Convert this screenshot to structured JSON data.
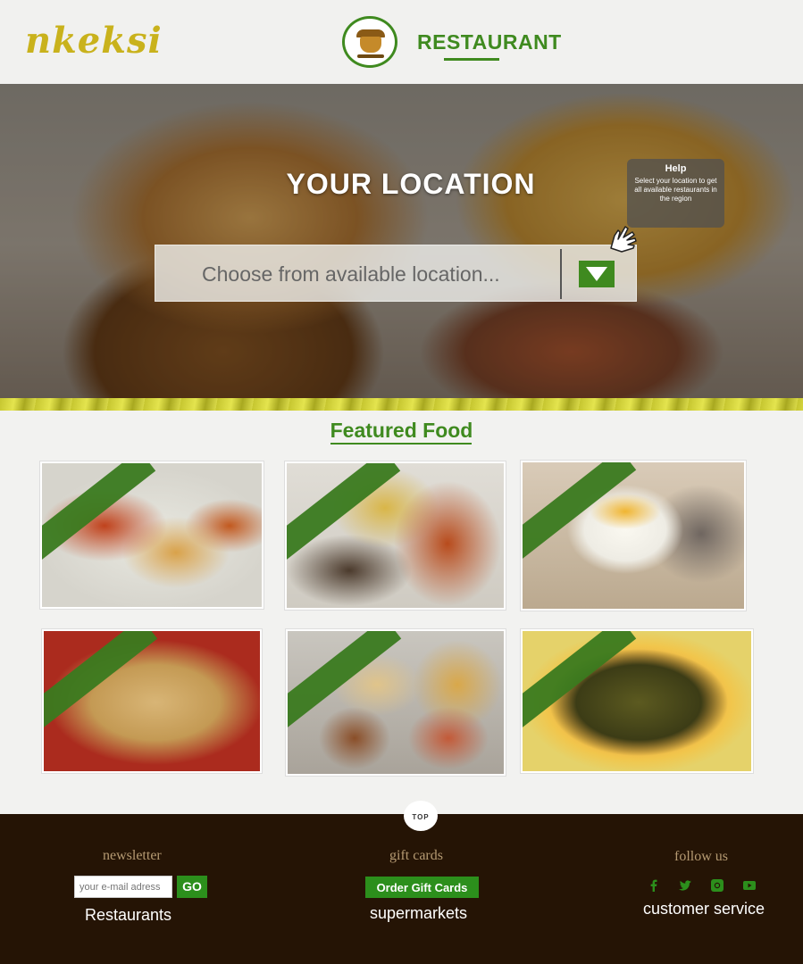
{
  "header": {
    "logo_text_a": "nke",
    "logo_text_b": "ksi",
    "section_title": "RESTAURANT",
    "section_icon": "restaurant-pot-icon"
  },
  "hero": {
    "title": "YOUR LOCATION",
    "location_placeholder": "Choose from available location...",
    "help_title": "Help",
    "help_text": "Select your location to get all available restaurants in the region"
  },
  "featured": {
    "title": "Featured Food",
    "items": [
      "food-1",
      "food-2",
      "food-3",
      "food-4",
      "food-5",
      "food-6"
    ]
  },
  "footer": {
    "top_label": "TOP",
    "newsletter_heading": "newsletter",
    "email_placeholder": "your e-mail adress",
    "go_label": "GO",
    "restaurants_link": "Restaurants",
    "gift_heading": "gift cards",
    "gift_button": "Order Gift Cards",
    "supermarkets_link": "supermarkets",
    "follow_heading": "follow us",
    "customer_service_link": "customer service",
    "social_icons": [
      "facebook-icon",
      "twitter-icon",
      "instagram-icon",
      "youtube-icon"
    ]
  },
  "colors": {
    "brand_green": "#3f8a1f",
    "button_green": "#2c8f1c",
    "footer_bg": "#251405",
    "footer_heading": "#b59a72"
  }
}
